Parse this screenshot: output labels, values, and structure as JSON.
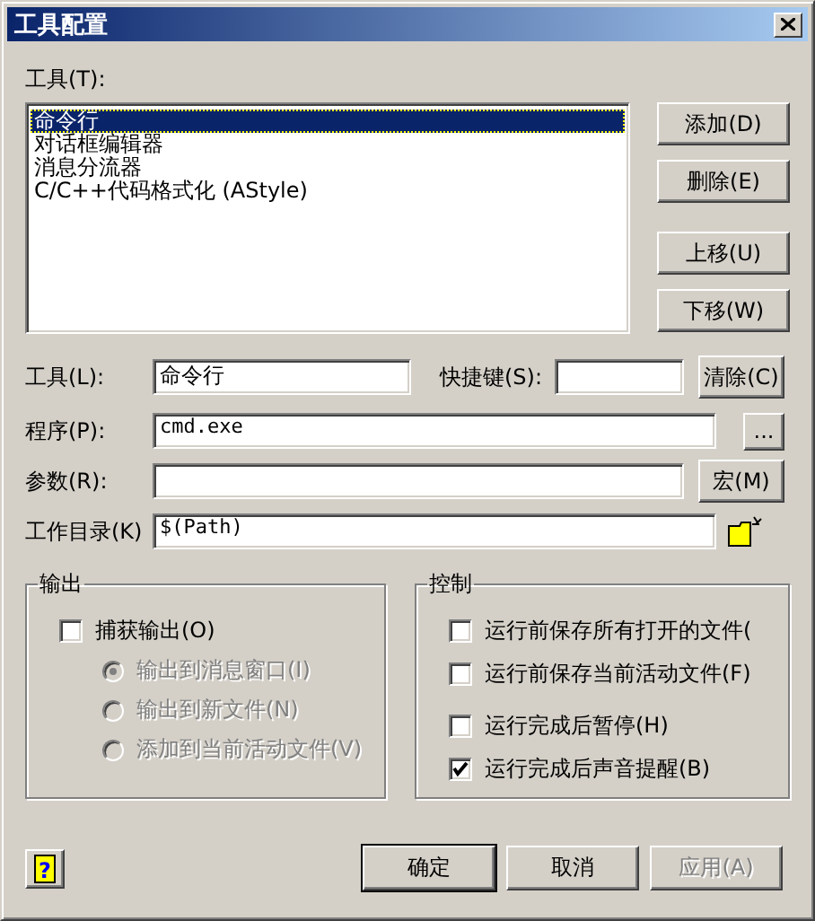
{
  "window": {
    "title": "工具配置"
  },
  "tools_label": "工具(T):",
  "tools": [
    {
      "label": "命令行",
      "selected": true
    },
    {
      "label": "对话框编辑器",
      "selected": false
    },
    {
      "label": "消息分流器",
      "selected": false
    },
    {
      "label": "C/C++代码格式化 (AStyle)",
      "selected": false
    }
  ],
  "list_buttons": [
    "添加(D)",
    "删除(E)",
    "上移(U)",
    "下移(W)"
  ],
  "tool_field": {
    "label": "工具(L):",
    "value": "命令行"
  },
  "shortcut_field": {
    "label": "快捷键(S):"
  },
  "clear_button": "清除(C)",
  "program_field": {
    "label": "程序(P):",
    "value": "cmd.exe"
  },
  "browse_button": "...",
  "args_field": {
    "label": "参数(R):"
  },
  "macro_button": "宏(M)",
  "dir_field": {
    "label": "工作目录(K)",
    "value": "$(Path)"
  },
  "output_group": {
    "title": "输出",
    "capture": {
      "label": "捕获输出(O)",
      "checked": false
    },
    "options": [
      {
        "label": "输出到消息窗口(I)",
        "selected": true,
        "disabled": true
      },
      {
        "label": "输出到新文件(N)",
        "selected": false,
        "disabled": true
      },
      {
        "label": "添加到当前活动文件(V)",
        "selected": false,
        "disabled": true
      }
    ]
  },
  "control_group": {
    "title": "控制",
    "options": [
      {
        "label": "运行前保存所有打开的文件(",
        "checked": false
      },
      {
        "label": "运行前保存当前活动文件(F)",
        "checked": false
      },
      {
        "label": "运行完成后暂停(H)",
        "checked": false
      },
      {
        "label": "运行完成后声音提醒(B)",
        "checked": true
      }
    ]
  },
  "help_button": "?",
  "buttons": [
    {
      "label": "确定",
      "default": true,
      "disabled": false
    },
    {
      "label": "取消",
      "default": false,
      "disabled": false
    },
    {
      "label": "应用(A)",
      "default": false,
      "disabled": true
    }
  ]
}
